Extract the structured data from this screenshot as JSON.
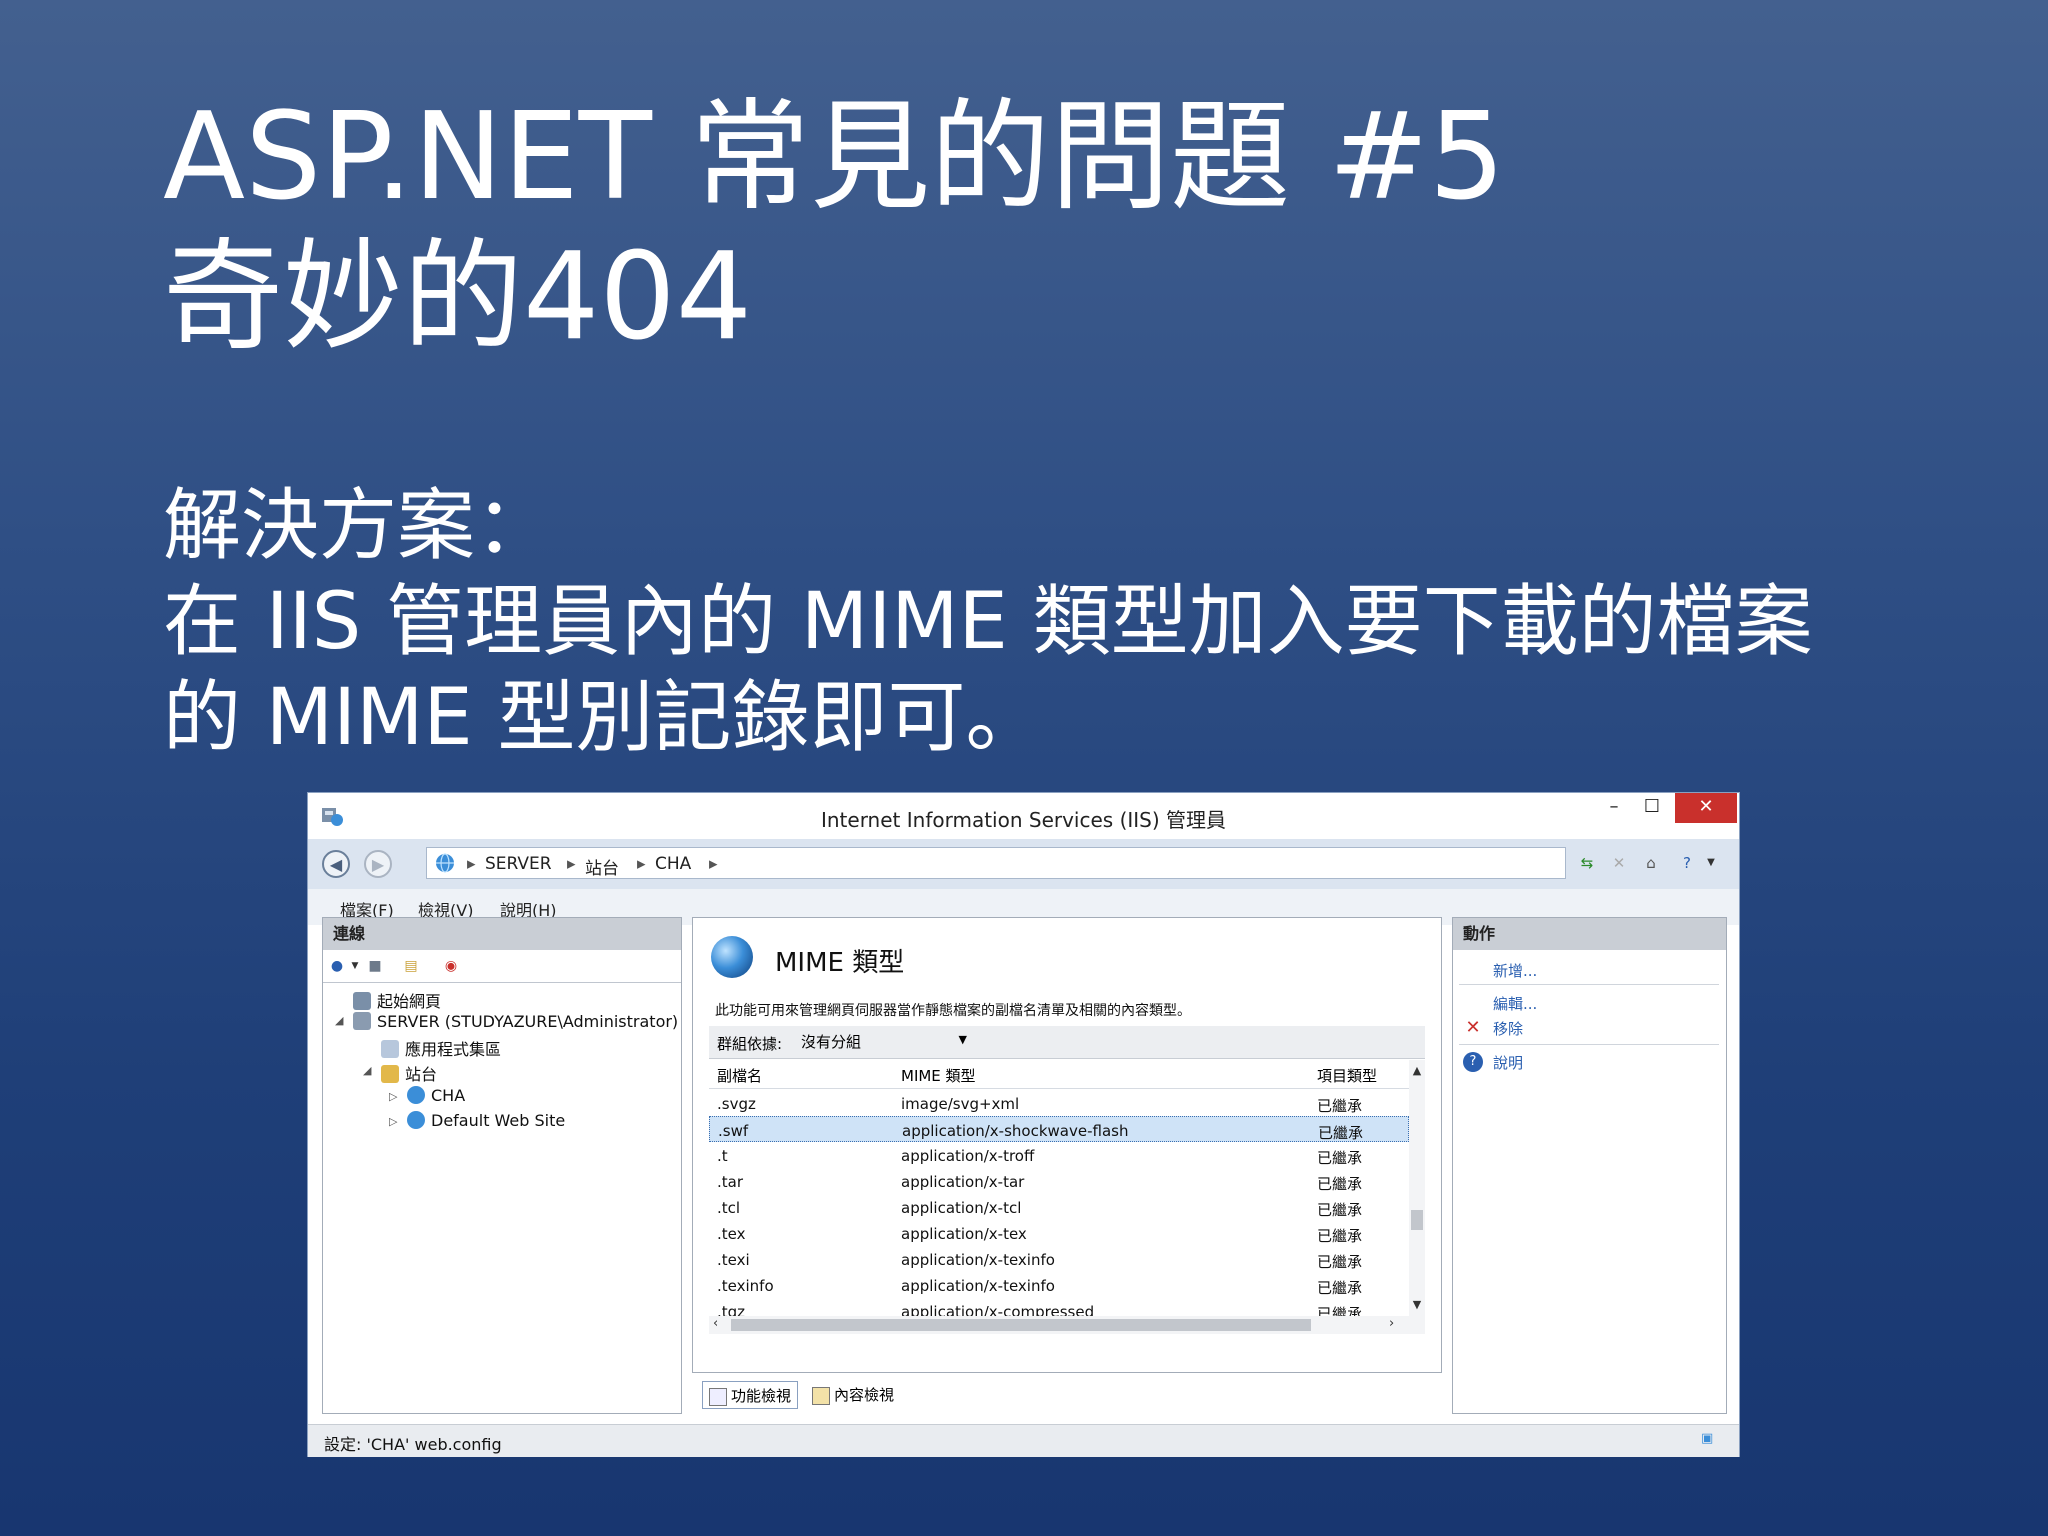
{
  "slide": {
    "title_line1": "ASP.NET 常見的問題 #5",
    "title_line2": "奇妙的404",
    "body_line1": "解決方案：",
    "body_line2": "在 IIS 管理員內的 MIME 類型加入要下載的檔案",
    "body_line3": "的 MIME 型別記錄即可。"
  },
  "window": {
    "title": "Internet Information Services (IIS) 管理員",
    "minimize": "–",
    "maximize": "☐",
    "close": "✕",
    "breadcrumb": [
      "SERVER",
      "站台",
      "CHA"
    ],
    "menu": [
      "檔案(F)",
      "檢視(V)",
      "說明(H)"
    ]
  },
  "connections": {
    "header": "連線",
    "tree": {
      "start_page": "起始網頁",
      "server": "SERVER (STUDYAZURE\\Administrator)",
      "app_pools": "應用程式集區",
      "sites": "站台",
      "site_cha": "CHA",
      "site_default": "Default Web Site"
    }
  },
  "mime": {
    "title": "MIME 類型",
    "description": "此功能可用來管理網頁伺服器當作靜態檔案的副檔名清單及相關的內容類型。",
    "group_label": "群組依據:",
    "group_value": "沒有分組",
    "columns": [
      "副檔名",
      "MIME 類型",
      "項目類型"
    ],
    "rows": [
      {
        "ext": ".svgz",
        "type": "image/svg+xml",
        "entry": "已繼承"
      },
      {
        "ext": ".swf",
        "type": "application/x-shockwave-flash",
        "entry": "已繼承"
      },
      {
        "ext": ".t",
        "type": "application/x-troff",
        "entry": "已繼承"
      },
      {
        "ext": ".tar",
        "type": "application/x-tar",
        "entry": "已繼承"
      },
      {
        "ext": ".tcl",
        "type": "application/x-tcl",
        "entry": "已繼承"
      },
      {
        "ext": ".tex",
        "type": "application/x-tex",
        "entry": "已繼承"
      },
      {
        "ext": ".texi",
        "type": "application/x-texinfo",
        "entry": "已繼承"
      },
      {
        "ext": ".texinfo",
        "type": "application/x-texinfo",
        "entry": "已繼承"
      },
      {
        "ext": ".tgz",
        "type": "application/x-compressed",
        "entry": "已繼承"
      }
    ],
    "selected_row": 1,
    "view_tabs": [
      "功能檢視",
      "內容檢視"
    ]
  },
  "actions": {
    "header": "動作",
    "add": "新增...",
    "edit": "編輯...",
    "remove": "移除",
    "help": "說明"
  },
  "status": {
    "text": "設定: 'CHA' web.config"
  },
  "colors": {
    "close_red": "#c9302c",
    "link_blue": "#2a5fb0",
    "selection": "#cfe3f7"
  }
}
